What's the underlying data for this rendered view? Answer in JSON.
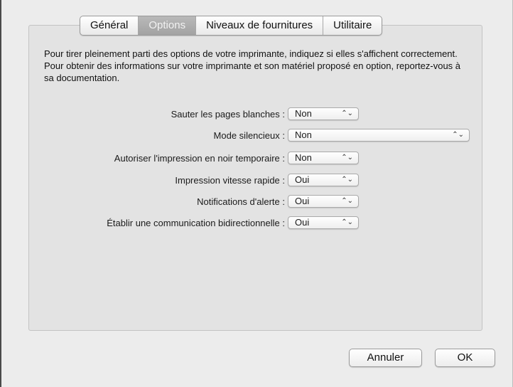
{
  "tabs": [
    {
      "label": "Général"
    },
    {
      "label": "Options"
    },
    {
      "label": "Niveaux de fournitures"
    },
    {
      "label": "Utilitaire"
    }
  ],
  "active_tab": "Options",
  "intro_text": "Pour tirer pleinement parti des options de votre imprimante, indiquez si elles s'affichent correctement. Pour obtenir des informations sur votre imprimante et son matériel proposé en option, reportez-vous à sa documentation.",
  "options": [
    {
      "label": "Sauter les pages blanches :",
      "value": "Non"
    },
    {
      "label": "Mode silencieux :",
      "value": "Non"
    },
    {
      "label": "Autoriser l'impression en noir temporaire :",
      "value": "Non"
    },
    {
      "label": "Impression vitesse rapide :",
      "value": "Oui"
    },
    {
      "label": "Notifications d'alerte :",
      "value": "Oui"
    },
    {
      "label": "Établir une communication bidirectionnelle :",
      "value": "Oui"
    }
  ],
  "select_arrow_glyph": "⌃⌄",
  "buttons": {
    "cancel": "Annuler",
    "ok": "OK"
  }
}
